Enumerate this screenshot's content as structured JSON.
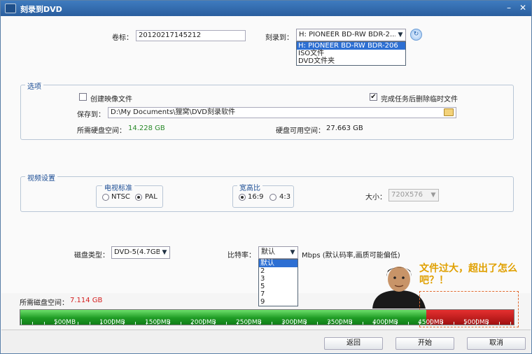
{
  "title": "刻录到DVD",
  "volume": {
    "label": "卷标：",
    "value": "20120217145212"
  },
  "burn_to": {
    "label": "刻录到：",
    "selected": "H: PIONEER  BD-RW   BDR-2...",
    "options": [
      "H: PIONEER  BD-RW   BDR-206",
      "ISO文件",
      "DVD文件夹"
    ]
  },
  "options_group": {
    "label": "选项",
    "create_image_label": "创建映像文件",
    "create_image_checked": false,
    "delete_temp_label": "完成任务后删除临时文件",
    "delete_temp_checked": true,
    "save_to_label": "保存到：",
    "save_to_value": "D:\\My Documents\\狸窝\\DVD刻录软件",
    "need_space_label": "所需硬盘空间：",
    "need_space_value": "14.228 GB",
    "free_space_label": "硬盘可用空间：",
    "free_space_value": "27.663 GB"
  },
  "video_group": {
    "label": "视频设置",
    "tv_standard_label": "电视标准",
    "ntsc": "NTSC",
    "pal": "PAL",
    "aspect_label": "宽高比",
    "ratio_169": "16:9",
    "ratio_43": "4:3",
    "size_label": "大小：",
    "size_value": "720X576"
  },
  "disc_type": {
    "label": "磁盘类型：",
    "value": "DVD-5(4.7GB)"
  },
  "bitrate": {
    "label": "比特率：",
    "value": "默认",
    "unit": "Mbps (默认码率,画质可能偏低)",
    "options": [
      "默认",
      "2",
      "3",
      "5",
      "7",
      "9"
    ]
  },
  "disk_space": {
    "label": "所需磁盘空间：",
    "value": "7.114 GB",
    "used_fraction": 0.7114,
    "capacity_fraction": 0.8233
  },
  "scale": [
    "500MB",
    "1000MB",
    "1500MB",
    "2000MB",
    "2500MB",
    "3000MB",
    "3500MB",
    "4000MB",
    "4500MB",
    "5000MB"
  ],
  "meme_caption": "文件过大，超出了怎么吧？！",
  "buttons": {
    "back": "返回",
    "start": "开始",
    "cancel": "取消"
  },
  "colors": {
    "titlebar": "#2a5e9e",
    "bar_green": "#1e9b24",
    "bar_red": "#c01818",
    "highlight": "#2d6fd3",
    "space_green": "#2a8a2a",
    "space_red": "#d42020",
    "caption": "#e0a000"
  }
}
